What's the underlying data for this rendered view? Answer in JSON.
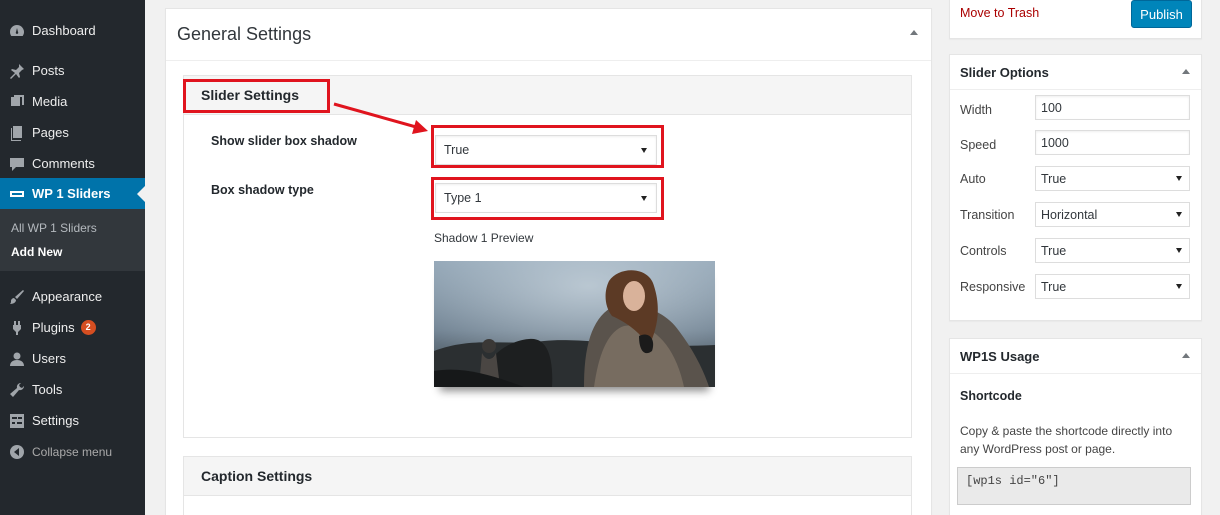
{
  "sidebar": {
    "items": [
      {
        "label": "Dashboard",
        "icon": "dashboard-icon"
      },
      {
        "label": "Posts",
        "icon": "pin-icon"
      },
      {
        "label": "Media",
        "icon": "media-icon"
      },
      {
        "label": "Pages",
        "icon": "pages-icon"
      },
      {
        "label": "Comments",
        "icon": "comment-icon"
      },
      {
        "label": "WP 1 Sliders",
        "icon": "slider-icon"
      },
      {
        "label": "Appearance",
        "icon": "brush-icon"
      },
      {
        "label": "Plugins",
        "icon": "plugin-icon",
        "badge": "2"
      },
      {
        "label": "Users",
        "icon": "user-icon"
      },
      {
        "label": "Tools",
        "icon": "wrench-icon"
      },
      {
        "label": "Settings",
        "icon": "settings-icon"
      }
    ],
    "submenu": [
      "All WP 1 Sliders",
      "Add New"
    ],
    "collapse": "Collapse menu"
  },
  "main": {
    "title": "General Settings",
    "slider_settings": {
      "title": "Slider Settings",
      "shadow_label": "Show slider box shadow",
      "shadow_value": "True",
      "type_label": "Box shadow type",
      "type_value": "Type 1",
      "preview_label": "Shadow 1 Preview"
    },
    "caption_settings": {
      "title": "Caption Settings"
    }
  },
  "publish": {
    "trash": "Move to Trash",
    "button": "Publish"
  },
  "slider_options": {
    "title": "Slider Options",
    "rows": [
      {
        "label": "Width",
        "value": "100"
      },
      {
        "label": "Speed",
        "value": "1000"
      },
      {
        "label": "Auto",
        "value": "True"
      },
      {
        "label": "Transition",
        "value": "Horizontal"
      },
      {
        "label": "Controls",
        "value": "True"
      },
      {
        "label": "Responsive",
        "value": "True"
      }
    ]
  },
  "usage": {
    "title": "WP1S Usage",
    "shortcode_label": "Shortcode",
    "description": "Copy & paste the shortcode directly into any WordPress post or page.",
    "shortcode": "[wp1s id=\"6\"]"
  },
  "colors": {
    "accent": "#0073aa",
    "highlight": "#e0141e",
    "trash": "#a00",
    "sidebar": "#23282d"
  }
}
